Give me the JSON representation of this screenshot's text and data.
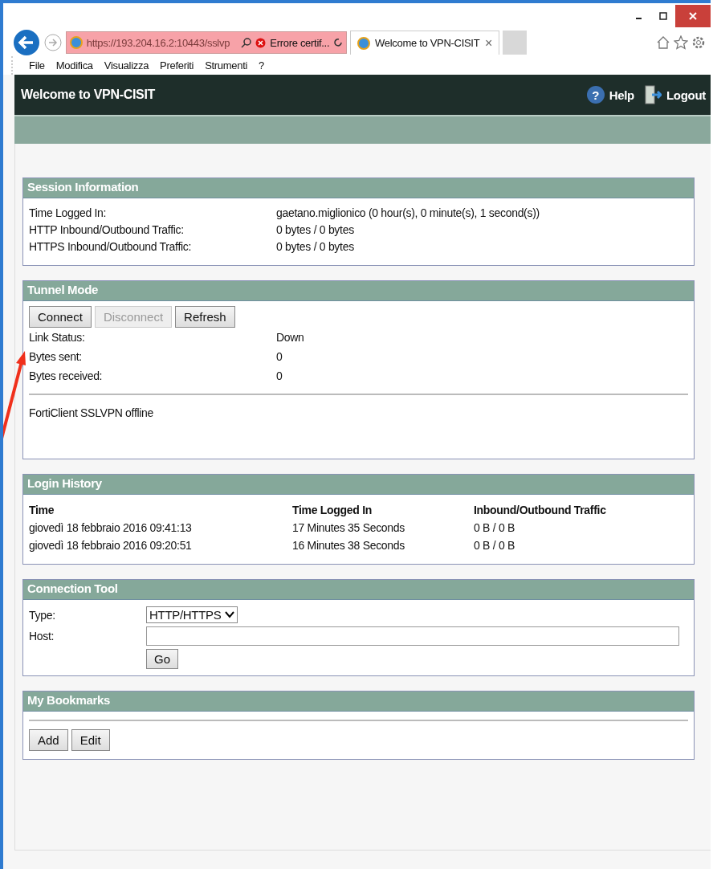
{
  "browser": {
    "address": "https://193.204.16.2:10443/sslvp",
    "cert_error": "Errore certif...",
    "tabs": [
      {
        "title": "Welcome to VPN-CISIT",
        "selected": true,
        "close": "×"
      }
    ],
    "menu": [
      "File",
      "Modifica",
      "Visualizza",
      "Preferiti",
      "Strumenti",
      "?"
    ]
  },
  "header": {
    "title": "Welcome to VPN-CISIT",
    "help_icon": "?",
    "help": "Help",
    "logout": "Logout"
  },
  "session": {
    "title": "Session Information",
    "rows": [
      {
        "label": "Time Logged In:",
        "value": "gaetano.miglionico (0 hour(s), 0 minute(s), 1 second(s))"
      },
      {
        "label": "HTTP Inbound/Outbound Traffic:",
        "value": "0 bytes / 0 bytes"
      },
      {
        "label": "HTTPS Inbound/Outbound Traffic:",
        "value": "0 bytes / 0 bytes"
      }
    ]
  },
  "tunnel": {
    "title": "Tunnel Mode",
    "buttons": [
      {
        "label": "Connect",
        "disabled": false
      },
      {
        "label": "Disconnect",
        "disabled": true
      },
      {
        "label": "Refresh",
        "disabled": false
      }
    ],
    "rows": [
      {
        "label": "Link Status:",
        "value": "Down"
      },
      {
        "label": "Bytes sent:",
        "value": "0"
      },
      {
        "label": "Bytes received:",
        "value": "0"
      }
    ],
    "message": "FortiClient SSLVPN offline"
  },
  "history": {
    "title": "Login History",
    "columns": [
      "Time",
      "Time Logged In",
      "Inbound/Outbound Traffic"
    ],
    "rows": [
      [
        "giovedì 18 febbraio 2016 09:41:13",
        "17 Minutes 35 Seconds",
        "0 B / 0 B"
      ],
      [
        "giovedì 18 febbraio 2016 09:20:51",
        "16 Minutes 38 Seconds",
        "0 B / 0 B"
      ]
    ]
  },
  "tool": {
    "title": "Connection Tool",
    "type_label": "Type:",
    "type_value": "HTTP/HTTPS",
    "host_label": "Host:",
    "go": "Go"
  },
  "bookmarks": {
    "title": "My Bookmarks",
    "buttons": [
      "Add",
      "Edit"
    ]
  }
}
